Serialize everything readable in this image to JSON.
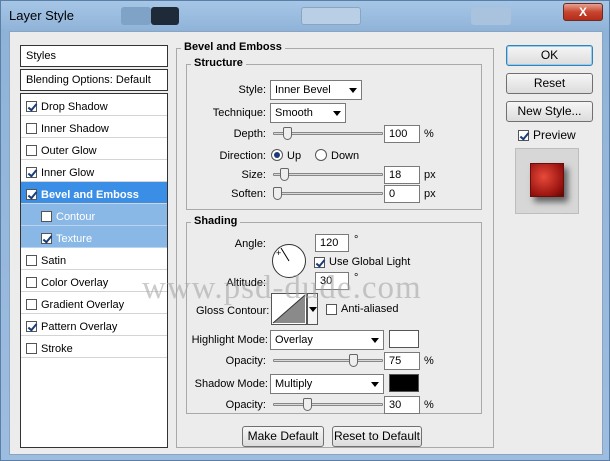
{
  "window": {
    "title": "Layer Style",
    "close_label": "X"
  },
  "left": {
    "styles_label": "Styles",
    "blending_label": "Blending Options: Default",
    "items": [
      {
        "label": "Drop Shadow",
        "checked": true
      },
      {
        "label": "Inner Shadow",
        "checked": false
      },
      {
        "label": "Outer Glow",
        "checked": false
      },
      {
        "label": "Inner Glow",
        "checked": true
      },
      {
        "label": "Bevel and Emboss",
        "checked": true,
        "selected": true
      },
      {
        "label": "Contour",
        "checked": false,
        "sub": true
      },
      {
        "label": "Texture",
        "checked": true,
        "sub": true
      },
      {
        "label": "Satin",
        "checked": false
      },
      {
        "label": "Color Overlay",
        "checked": false
      },
      {
        "label": "Gradient Overlay",
        "checked": false
      },
      {
        "label": "Pattern Overlay",
        "checked": true
      },
      {
        "label": "Stroke",
        "checked": false
      }
    ]
  },
  "bevel": {
    "title": "Bevel and Emboss",
    "structure_title": "Structure",
    "style_label": "Style:",
    "style_value": "Inner Bevel",
    "technique_label": "Technique:",
    "technique_value": "Smooth",
    "depth_label": "Depth:",
    "depth_value": "100",
    "depth_unit": "%",
    "direction_label": "Direction:",
    "up_label": "Up",
    "down_label": "Down",
    "size_label": "Size:",
    "size_value": "18",
    "size_unit": "px",
    "soften_label": "Soften:",
    "soften_value": "0",
    "soften_unit": "px"
  },
  "shading": {
    "title": "Shading",
    "angle_label": "Angle:",
    "angle_value": "120",
    "angle_unit": "°",
    "global_light_label": "Use Global Light",
    "altitude_label": "Altitude:",
    "altitude_value": "30",
    "altitude_unit": "°",
    "gloss_label": "Gloss Contour:",
    "anti_aliased_label": "Anti-aliased",
    "highlight_label": "Highlight Mode:",
    "highlight_value": "Overlay",
    "highlight_color": "#ffffff",
    "hl_opacity_label": "Opacity:",
    "hl_opacity_value": "75",
    "hl_opacity_unit": "%",
    "shadow_label": "Shadow Mode:",
    "shadow_value": "Multiply",
    "shadow_color": "#000000",
    "sh_opacity_label": "Opacity:",
    "sh_opacity_value": "30",
    "sh_opacity_unit": "%"
  },
  "buttons": {
    "make_default": "Make Default",
    "reset_default": "Reset to Default",
    "ok": "OK",
    "reset": "Reset",
    "new_style": "New Style...",
    "preview": "Preview"
  },
  "watermark": "www.psd-dude.com"
}
